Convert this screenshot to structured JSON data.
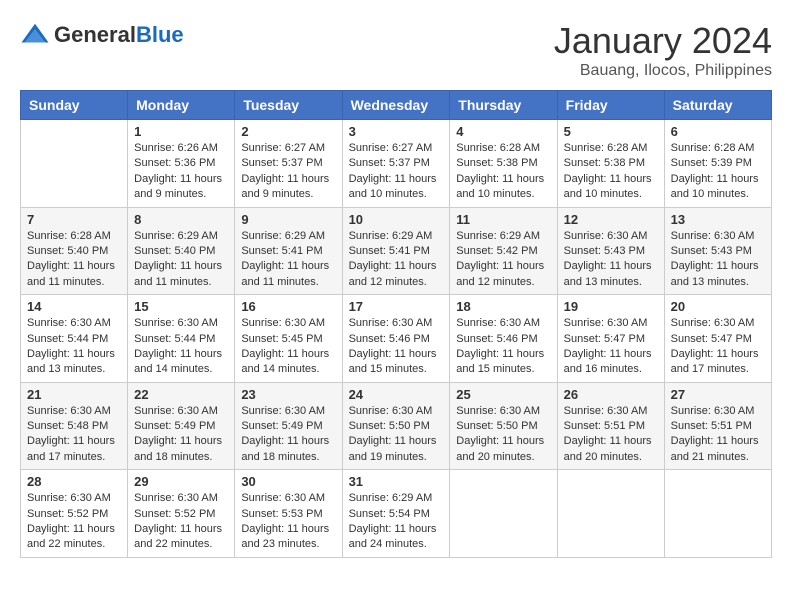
{
  "logo": {
    "text_general": "General",
    "text_blue": "Blue"
  },
  "title": {
    "month_year": "January 2024",
    "location": "Bauang, Ilocos, Philippines"
  },
  "days_of_week": [
    "Sunday",
    "Monday",
    "Tuesday",
    "Wednesday",
    "Thursday",
    "Friday",
    "Saturday"
  ],
  "weeks": [
    [
      {
        "day": "",
        "sunrise": "",
        "sunset": "",
        "daylight": ""
      },
      {
        "day": "1",
        "sunrise": "Sunrise: 6:26 AM",
        "sunset": "Sunset: 5:36 PM",
        "daylight": "Daylight: 11 hours and 9 minutes."
      },
      {
        "day": "2",
        "sunrise": "Sunrise: 6:27 AM",
        "sunset": "Sunset: 5:37 PM",
        "daylight": "Daylight: 11 hours and 9 minutes."
      },
      {
        "day": "3",
        "sunrise": "Sunrise: 6:27 AM",
        "sunset": "Sunset: 5:37 PM",
        "daylight": "Daylight: 11 hours and 10 minutes."
      },
      {
        "day": "4",
        "sunrise": "Sunrise: 6:28 AM",
        "sunset": "Sunset: 5:38 PM",
        "daylight": "Daylight: 11 hours and 10 minutes."
      },
      {
        "day": "5",
        "sunrise": "Sunrise: 6:28 AM",
        "sunset": "Sunset: 5:38 PM",
        "daylight": "Daylight: 11 hours and 10 minutes."
      },
      {
        "day": "6",
        "sunrise": "Sunrise: 6:28 AM",
        "sunset": "Sunset: 5:39 PM",
        "daylight": "Daylight: 11 hours and 10 minutes."
      }
    ],
    [
      {
        "day": "7",
        "sunrise": "Sunrise: 6:28 AM",
        "sunset": "Sunset: 5:40 PM",
        "daylight": "Daylight: 11 hours and 11 minutes."
      },
      {
        "day": "8",
        "sunrise": "Sunrise: 6:29 AM",
        "sunset": "Sunset: 5:40 PM",
        "daylight": "Daylight: 11 hours and 11 minutes."
      },
      {
        "day": "9",
        "sunrise": "Sunrise: 6:29 AM",
        "sunset": "Sunset: 5:41 PM",
        "daylight": "Daylight: 11 hours and 11 minutes."
      },
      {
        "day": "10",
        "sunrise": "Sunrise: 6:29 AM",
        "sunset": "Sunset: 5:41 PM",
        "daylight": "Daylight: 11 hours and 12 minutes."
      },
      {
        "day": "11",
        "sunrise": "Sunrise: 6:29 AM",
        "sunset": "Sunset: 5:42 PM",
        "daylight": "Daylight: 11 hours and 12 minutes."
      },
      {
        "day": "12",
        "sunrise": "Sunrise: 6:30 AM",
        "sunset": "Sunset: 5:43 PM",
        "daylight": "Daylight: 11 hours and 13 minutes."
      },
      {
        "day": "13",
        "sunrise": "Sunrise: 6:30 AM",
        "sunset": "Sunset: 5:43 PM",
        "daylight": "Daylight: 11 hours and 13 minutes."
      }
    ],
    [
      {
        "day": "14",
        "sunrise": "Sunrise: 6:30 AM",
        "sunset": "Sunset: 5:44 PM",
        "daylight": "Daylight: 11 hours and 13 minutes."
      },
      {
        "day": "15",
        "sunrise": "Sunrise: 6:30 AM",
        "sunset": "Sunset: 5:44 PM",
        "daylight": "Daylight: 11 hours and 14 minutes."
      },
      {
        "day": "16",
        "sunrise": "Sunrise: 6:30 AM",
        "sunset": "Sunset: 5:45 PM",
        "daylight": "Daylight: 11 hours and 14 minutes."
      },
      {
        "day": "17",
        "sunrise": "Sunrise: 6:30 AM",
        "sunset": "Sunset: 5:46 PM",
        "daylight": "Daylight: 11 hours and 15 minutes."
      },
      {
        "day": "18",
        "sunrise": "Sunrise: 6:30 AM",
        "sunset": "Sunset: 5:46 PM",
        "daylight": "Daylight: 11 hours and 15 minutes."
      },
      {
        "day": "19",
        "sunrise": "Sunrise: 6:30 AM",
        "sunset": "Sunset: 5:47 PM",
        "daylight": "Daylight: 11 hours and 16 minutes."
      },
      {
        "day": "20",
        "sunrise": "Sunrise: 6:30 AM",
        "sunset": "Sunset: 5:47 PM",
        "daylight": "Daylight: 11 hours and 17 minutes."
      }
    ],
    [
      {
        "day": "21",
        "sunrise": "Sunrise: 6:30 AM",
        "sunset": "Sunset: 5:48 PM",
        "daylight": "Daylight: 11 hours and 17 minutes."
      },
      {
        "day": "22",
        "sunrise": "Sunrise: 6:30 AM",
        "sunset": "Sunset: 5:49 PM",
        "daylight": "Daylight: 11 hours and 18 minutes."
      },
      {
        "day": "23",
        "sunrise": "Sunrise: 6:30 AM",
        "sunset": "Sunset: 5:49 PM",
        "daylight": "Daylight: 11 hours and 18 minutes."
      },
      {
        "day": "24",
        "sunrise": "Sunrise: 6:30 AM",
        "sunset": "Sunset: 5:50 PM",
        "daylight": "Daylight: 11 hours and 19 minutes."
      },
      {
        "day": "25",
        "sunrise": "Sunrise: 6:30 AM",
        "sunset": "Sunset: 5:50 PM",
        "daylight": "Daylight: 11 hours and 20 minutes."
      },
      {
        "day": "26",
        "sunrise": "Sunrise: 6:30 AM",
        "sunset": "Sunset: 5:51 PM",
        "daylight": "Daylight: 11 hours and 20 minutes."
      },
      {
        "day": "27",
        "sunrise": "Sunrise: 6:30 AM",
        "sunset": "Sunset: 5:51 PM",
        "daylight": "Daylight: 11 hours and 21 minutes."
      }
    ],
    [
      {
        "day": "28",
        "sunrise": "Sunrise: 6:30 AM",
        "sunset": "Sunset: 5:52 PM",
        "daylight": "Daylight: 11 hours and 22 minutes."
      },
      {
        "day": "29",
        "sunrise": "Sunrise: 6:30 AM",
        "sunset": "Sunset: 5:52 PM",
        "daylight": "Daylight: 11 hours and 22 minutes."
      },
      {
        "day": "30",
        "sunrise": "Sunrise: 6:30 AM",
        "sunset": "Sunset: 5:53 PM",
        "daylight": "Daylight: 11 hours and 23 minutes."
      },
      {
        "day": "31",
        "sunrise": "Sunrise: 6:29 AM",
        "sunset": "Sunset: 5:54 PM",
        "daylight": "Daylight: 11 hours and 24 minutes."
      },
      {
        "day": "",
        "sunrise": "",
        "sunset": "",
        "daylight": ""
      },
      {
        "day": "",
        "sunrise": "",
        "sunset": "",
        "daylight": ""
      },
      {
        "day": "",
        "sunrise": "",
        "sunset": "",
        "daylight": ""
      }
    ]
  ]
}
